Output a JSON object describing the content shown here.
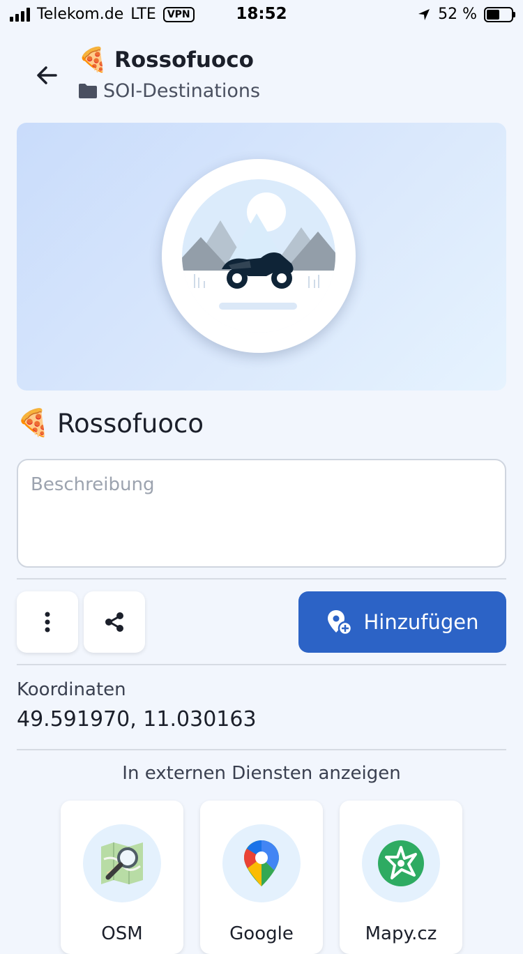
{
  "status_bar": {
    "carrier": "Telekom.de",
    "network": "LTE",
    "vpn": "VPN",
    "time": "18:52",
    "battery": "52 %"
  },
  "header": {
    "emoji": "🍕",
    "title": "Rossofuoco",
    "folder": "SOI-Destinations"
  },
  "place": {
    "emoji": "🍕",
    "title": "Rossofuoco",
    "description_value": "",
    "description_placeholder": "Beschreibung"
  },
  "actions": {
    "add_label": "Hinzufügen"
  },
  "coordinates": {
    "label": "Koordinaten",
    "value": "49.591970, 11.030163"
  },
  "external": {
    "title": "In externen Diensten anzeigen",
    "services": [
      {
        "label": "OSM",
        "icon": "osm-map-icon"
      },
      {
        "label": "Google",
        "icon": "google-maps-icon"
      },
      {
        "label": "Mapy.cz",
        "icon": "mapy-icon"
      }
    ]
  },
  "colors": {
    "accent": "#2c63c6",
    "background": "#f2f6fd",
    "mapy_green": "#2eab62"
  }
}
